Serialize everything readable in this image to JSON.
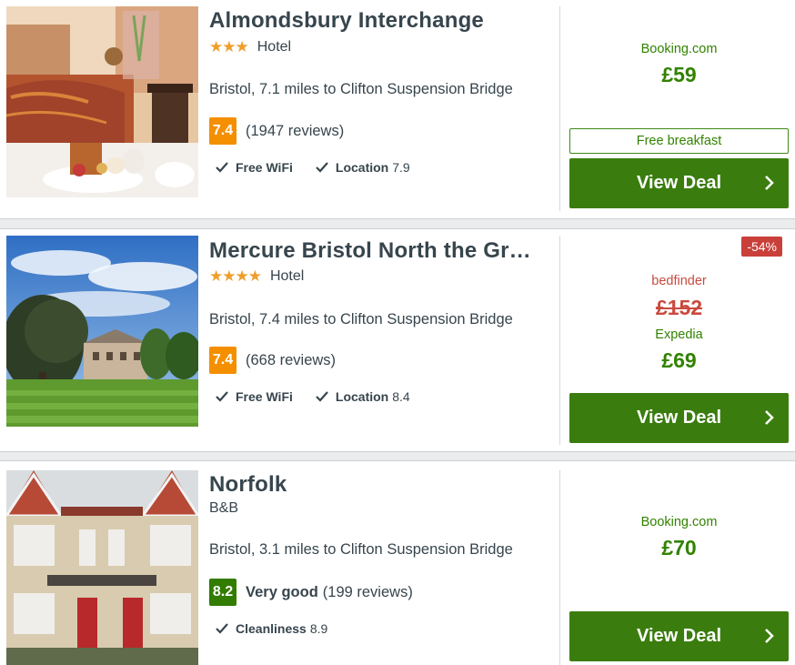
{
  "hotels": [
    {
      "name": "Almondsbury Interchange",
      "stars": "★★★",
      "type": "Hotel",
      "location": "Bristol, 7.1 miles to Clifton Suspension Bridge",
      "score": "7.4",
      "verdict": "",
      "reviews": "(1947 reviews)",
      "features": [
        {
          "label": "Free WiFi",
          "value": ""
        },
        {
          "label": "Location",
          "value": "7.9"
        }
      ],
      "deal": {
        "provider": "Booking.com",
        "price": "£59",
        "perk": "Free breakfast",
        "button": "View Deal"
      }
    },
    {
      "name": "Mercure Bristol North the Gr…",
      "stars": "★★★★",
      "type": "Hotel",
      "location": "Bristol, 7.4 miles to Clifton Suspension Bridge",
      "score": "7.4",
      "verdict": "",
      "reviews": "(668 reviews)",
      "features": [
        {
          "label": "Free WiFi",
          "value": ""
        },
        {
          "label": "Location",
          "value": "8.4"
        }
      ],
      "deal": {
        "discount": "-54%",
        "old_provider": "bedfinder",
        "old_price": "£152",
        "provider": "Expedia",
        "price": "£69",
        "button": "View Deal"
      }
    },
    {
      "name": "Norfolk",
      "stars": "",
      "type": "B&B",
      "location": "Bristol, 3.1 miles to Clifton Suspension Bridge",
      "score": "8.2",
      "verdict": "Very good",
      "reviews": "(199 reviews)",
      "features": [
        {
          "label": "Cleanliness",
          "value": "8.9"
        }
      ],
      "deal": {
        "provider": "Booking.com",
        "price": "£70",
        "button": "View Deal"
      }
    }
  ],
  "colors": {
    "accent_green": "#3a7d0e",
    "score_orange": "#f48f00",
    "score_green": "#327c00",
    "star_orange": "#f09e2b",
    "discount_red": "#c9403a"
  },
  "icons": {
    "check": "check-icon",
    "chevron": "chevron-right-icon",
    "star": "star-icon"
  }
}
